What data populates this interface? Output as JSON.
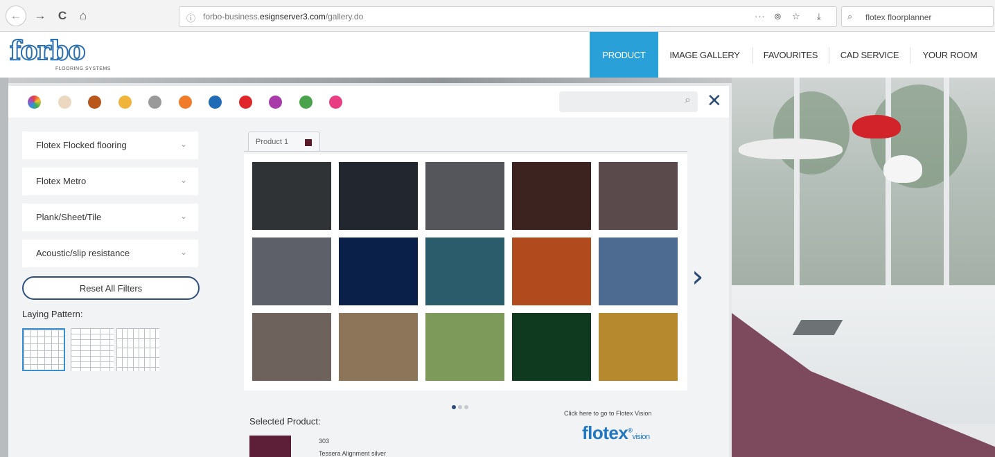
{
  "browser": {
    "url_prefix": "forbo-business.",
    "url_domain": "esignserver3.com",
    "url_path": "/gallery.do",
    "search_text": "flotex floorplanner",
    "more_label": "···"
  },
  "site": {
    "logo": "forbo",
    "logo_sub": "FLOORING SYSTEMS",
    "nav": [
      "PRODUCT",
      "IMAGE GALLERY",
      "FAVOURITES",
      "CAD SERVICE",
      "YOUR ROOM"
    ],
    "active_nav": "PRODUCT"
  },
  "color_filter": {
    "swatches": [
      "multi",
      "#ecd8c0",
      "#b8561c",
      "#f0b43a",
      "#9a9a9a",
      "#f07c2a",
      "#1f6bb5",
      "#e0262a",
      "#a93aa9",
      "#4aa24a",
      "#e83d83"
    ]
  },
  "filters": [
    "Flotex Flocked flooring",
    "Flotex Metro",
    "Plank/Sheet/Tile",
    "Acoustic/slip resistance"
  ],
  "reset_label": "Reset All Filters",
  "laying_label": "Laying Pattern:",
  "tab_label": "Product 1",
  "product_tiles": [
    "#2f3336",
    "#22272f",
    "#55565b",
    "#3c2320",
    "#5a4a4b",
    "#5d6068",
    "#0b2048",
    "#2a5c6b",
    "#b14a1c",
    "#4d6b90",
    "#6e625c",
    "#8c7558",
    "#7e9a5a",
    "#0f3a20",
    "#b7892e"
  ],
  "selected": {
    "label": "Selected Product:",
    "code": "303",
    "name": "Tessera Alignment silver",
    "swatch": "#5c1f37"
  },
  "vision": {
    "cta": "Click here to go to Flotex Vision",
    "brand": "flotex",
    "reg": "®",
    "suffix": "vision"
  },
  "icons": {
    "back": "←",
    "forward": "→",
    "reload": "C",
    "home": "⌂",
    "info": "ⓘ",
    "bookmark": "☆",
    "pocket": "⊚",
    "download": "⤓",
    "search": "⌕",
    "close": "✕",
    "chevron": "⌄",
    "next": "›"
  }
}
